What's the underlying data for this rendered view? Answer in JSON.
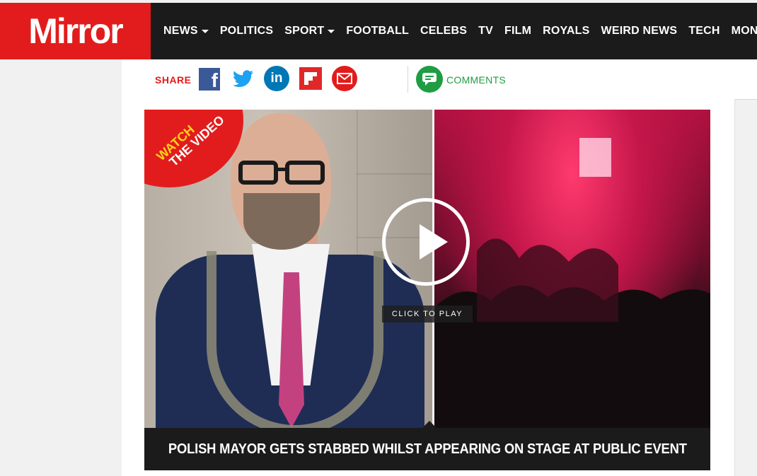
{
  "brand": {
    "logo_text": "Mirror",
    "accent": "#e21c1c",
    "nav_bg": "#1b1b1b"
  },
  "nav": {
    "items": [
      {
        "label": "NEWS",
        "dropdown": true
      },
      {
        "label": "POLITICS",
        "dropdown": false
      },
      {
        "label": "SPORT",
        "dropdown": true
      },
      {
        "label": "FOOTBALL",
        "dropdown": false
      },
      {
        "label": "CELEBS",
        "dropdown": false
      },
      {
        "label": "TV",
        "dropdown": false
      },
      {
        "label": "FILM",
        "dropdown": false
      },
      {
        "label": "ROYALS",
        "dropdown": false
      },
      {
        "label": "WEIRD NEWS",
        "dropdown": false
      },
      {
        "label": "TECH",
        "dropdown": false
      },
      {
        "label": "MONEY",
        "dropdown": false
      }
    ]
  },
  "share": {
    "label": "SHARE",
    "icons": [
      "facebook-icon",
      "twitter-icon",
      "linkedin-icon",
      "flipboard-icon",
      "email-icon"
    ],
    "comments_label": "COMMENTS",
    "comments_color": "#1f9d43"
  },
  "video": {
    "badge_watch": "WATCH",
    "badge_video": "THE VIDEO",
    "click_to_play": "CLICK TO PLAY",
    "caption": "POLISH MAYOR GETS STABBED WHILST APPEARING ON STAGE AT PUBLIC EVENT"
  }
}
